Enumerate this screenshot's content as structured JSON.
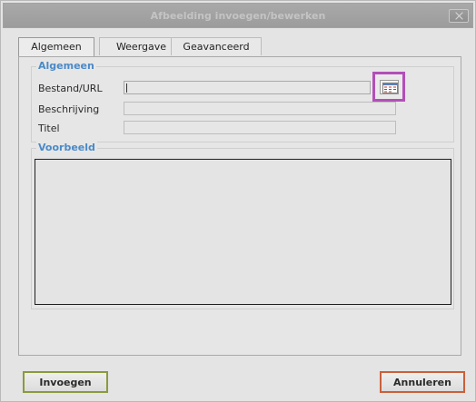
{
  "dialog": {
    "title": "Afbeelding invoegen/bewerken",
    "close_icon": "close-icon"
  },
  "tabs": [
    {
      "label": "Algemeen",
      "active": true
    },
    {
      "label": "Weergave",
      "active": false
    },
    {
      "label": "Geavanceerd",
      "active": false
    }
  ],
  "general_group": {
    "legend": "Algemeen",
    "fields": {
      "url_label": "Bestand/URL",
      "url_value": "",
      "description_label": "Beschrijving",
      "description_value": "",
      "title_label": "Titel",
      "title_value": ""
    },
    "browse_icon": "browse-files-icon"
  },
  "preview_group": {
    "legend": "Voorbeeld"
  },
  "buttons": {
    "insert": "Invoegen",
    "cancel": "Annuleren"
  },
  "colors": {
    "accent_legend": "#4a8ac8",
    "highlight_browse": "#b24fb8",
    "insert_border": "#8a9a3c",
    "cancel_border": "#c9603a"
  }
}
